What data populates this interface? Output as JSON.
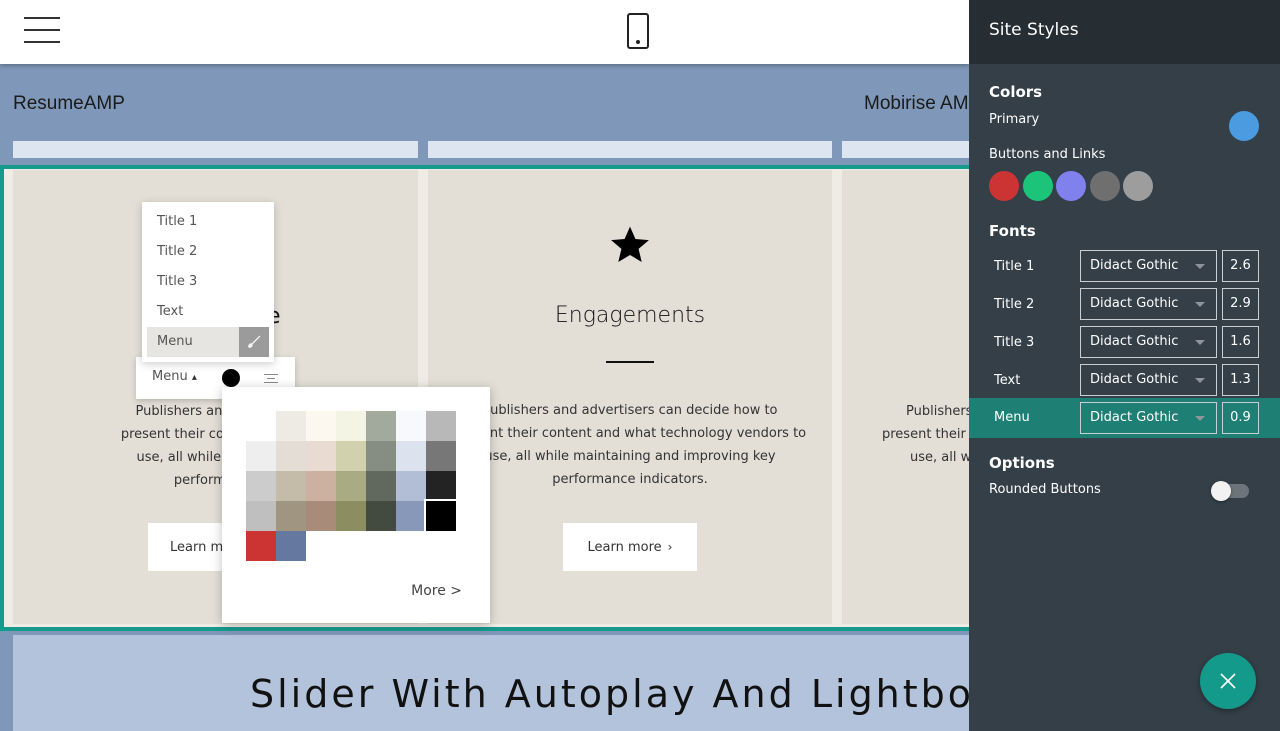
{
  "header": {
    "brand_left": "ResumeAMP",
    "brand_right": "Mobirise AMP"
  },
  "cards": [
    {
      "title": "",
      "text": "Publishers and advertisers can decide how to present their content and what technology vendors to use, all while maintaining and improving key performance indicators.",
      "button": "Learn more",
      "visible_text_lines": [
        "Publishers and advertise",
        "present their content and wh",
        "use, all while maintainin",
        "performance"
      ],
      "visible_button": "Learn mo"
    },
    {
      "title": "Engagements",
      "text_lines": [
        "Publishers and advertisers can decide how to",
        "present their content and what technology vendors to",
        "use, all while maintaining and improving key",
        "performance indicators."
      ],
      "button": "Learn more",
      "icon": "star-icon"
    },
    {
      "text_lines": [
        "Publishers",
        "present their c",
        "use, all wh"
      ]
    }
  ],
  "slider": {
    "title": "Slider With Autoplay And Lightbox"
  },
  "style_menu": {
    "items": [
      "Title 1",
      "Title 2",
      "Title 3",
      "Text",
      "Menu"
    ],
    "active": "Menu",
    "partial_title_char": "e"
  },
  "text_toolbar": {
    "menu_label": "Menu",
    "caret": "▴",
    "current_color": "#000000"
  },
  "palette": {
    "swatches": [
      [
        "#ffffff",
        "#eeeae4",
        "#fcf8f0",
        "#f3f4e4",
        "#a2aa9e",
        "#f8f9fc",
        "#b8b8b8"
      ],
      [
        "#eeeeee",
        "#e3ddd5",
        "#e9dbd1",
        "#d2d1ae",
        "#868e83",
        "#dde3ee",
        "#777777"
      ],
      [
        "#cccccc",
        "#c5bba9",
        "#cdb1a0",
        "#a9ab83",
        "#61695f",
        "#b1bed6",
        "#232323"
      ],
      [
        "#bfbfbf",
        "#9f9581",
        "#a88b78",
        "#8c8e62",
        "#434b41",
        "#8798b8",
        "#000000"
      ],
      [
        "#cc3333",
        "#6478a0"
      ]
    ],
    "selected": "#000000",
    "more_label": "More >"
  },
  "panel": {
    "title": "Site Styles",
    "colors_label": "Colors",
    "primary_label": "Primary",
    "primary_color": "#4a9be0",
    "buttons_links_label": "Buttons and Links",
    "button_colors": [
      "#cc3333",
      "#1cc47a",
      "#8181ee",
      "#6f6f6f",
      "#9d9d9d"
    ],
    "fonts_label": "Fonts",
    "fonts": [
      {
        "label": "Title 1",
        "font": "Didact Gothic",
        "size": "2.6"
      },
      {
        "label": "Title 2",
        "font": "Didact Gothic",
        "size": "2.9"
      },
      {
        "label": "Title 3",
        "font": "Didact Gothic",
        "size": "1.6"
      },
      {
        "label": "Text",
        "font": "Didact Gothic",
        "size": "1.3"
      },
      {
        "label": "Menu",
        "font": "Didact Gothic",
        "size": "0.9"
      }
    ],
    "options_label": "Options",
    "rounded_buttons_label": "Rounded Buttons",
    "rounded_buttons_on": false
  },
  "colors": {
    "accent": "#159a8c",
    "panel_bg": "#343f48",
    "panel_header_bg": "#262d33",
    "highlight_row": "#1e7f74"
  }
}
